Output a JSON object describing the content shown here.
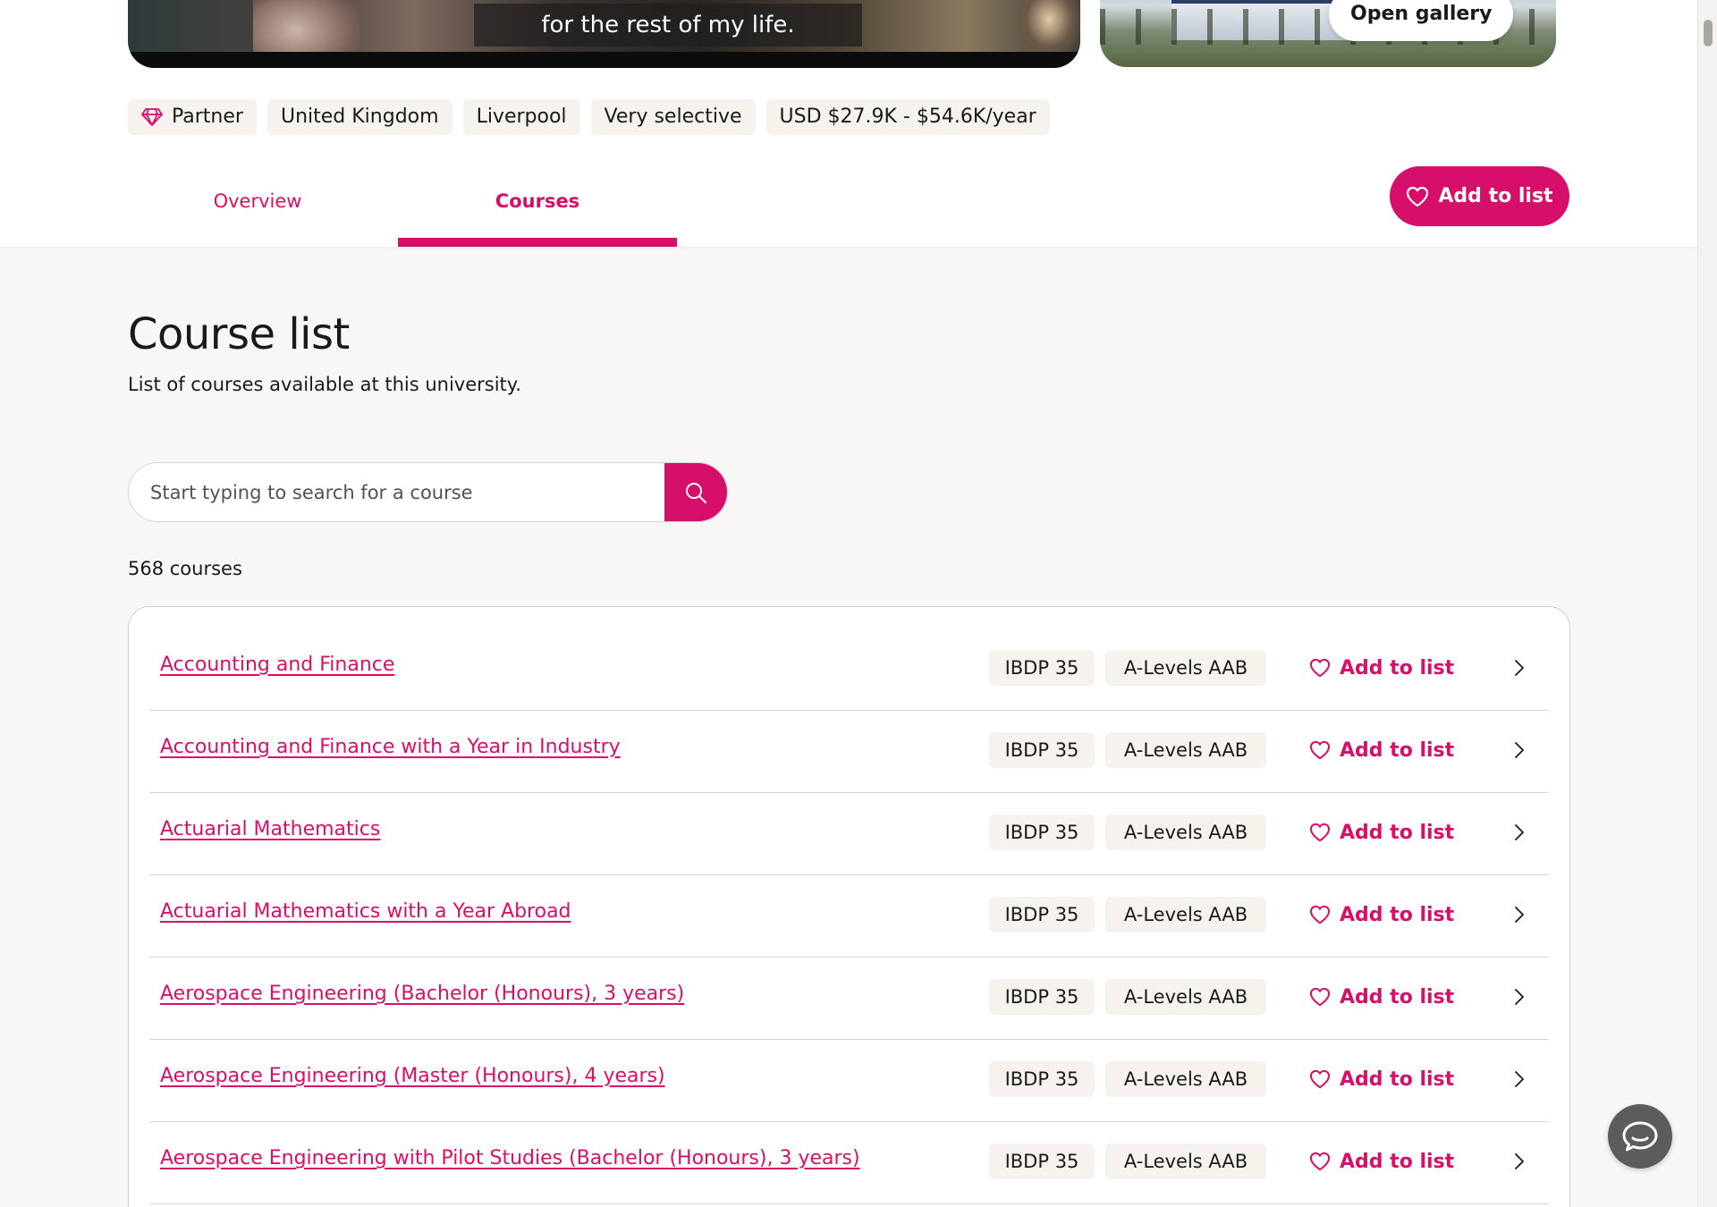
{
  "media": {
    "video_caption": "for the rest of my life.",
    "gallery_button": "Open gallery"
  },
  "tags": [
    {
      "label": "Partner",
      "icon": "diamond-icon"
    },
    {
      "label": "United Kingdom"
    },
    {
      "label": "Liverpool"
    },
    {
      "label": "Very selective"
    },
    {
      "label": "USD $27.9K - $54.6K/year"
    }
  ],
  "tabs": [
    {
      "label": "Overview",
      "active": false
    },
    {
      "label": "Courses",
      "active": true
    }
  ],
  "header_add_label": "Add to list",
  "course_list": {
    "title": "Course list",
    "subtitle": "List of courses available at this university.",
    "search_placeholder": "Start typing to search for a course",
    "count_text": "568 courses",
    "courses": [
      {
        "name": "Accounting and Finance",
        "ib": "IBDP 35",
        "alevel": "A-Levels AAB",
        "add_label": "Add to list"
      },
      {
        "name": "Accounting and Finance with a Year in Industry",
        "ib": "IBDP 35",
        "alevel": "A-Levels AAB",
        "add_label": "Add to list"
      },
      {
        "name": "Actuarial Mathematics",
        "ib": "IBDP 35",
        "alevel": "A-Levels AAB",
        "add_label": "Add to list"
      },
      {
        "name": "Actuarial Mathematics with a Year Abroad",
        "ib": "IBDP 35",
        "alevel": "A-Levels AAB",
        "add_label": "Add to list"
      },
      {
        "name": "Aerospace Engineering (Bachelor (Honours), 3 years)",
        "ib": "IBDP 35",
        "alevel": "A-Levels AAB",
        "add_label": "Add to list"
      },
      {
        "name": "Aerospace Engineering (Master (Honours), 4 years)",
        "ib": "IBDP 35",
        "alevel": "A-Levels AAB",
        "add_label": "Add to list"
      },
      {
        "name": "Aerospace Engineering with Pilot Studies (Bachelor (Honours), 3 years)",
        "ib": "IBDP 35",
        "alevel": "A-Levels AAB",
        "add_label": "Add to list"
      }
    ]
  },
  "colors": {
    "accent": "#d60f6b",
    "page_bg": "#f8f7f5",
    "tag_bg": "#f6f3ef",
    "chat_button": "#5d5c5a"
  },
  "icons": {
    "heart": "heart-icon",
    "search": "search-icon",
    "chevron": "chevron-right-icon",
    "chat": "chat-icon",
    "diamond": "diamond-icon"
  }
}
